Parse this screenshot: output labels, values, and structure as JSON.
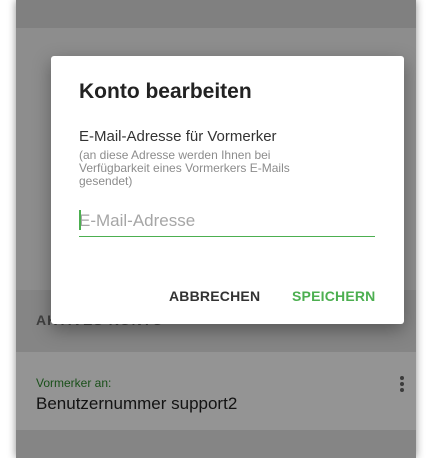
{
  "background": {
    "section_title": "AKTIVES KONTO",
    "account_label": "Vormerker an:",
    "account_value": "Benutzernummer support2"
  },
  "dialog": {
    "title": "Konto bearbeiten",
    "field_label": "E-Mail-Adresse für Vormerker",
    "field_hint": "(an diese Adresse werden Ihnen bei Verfügbarkeit eines Vormerkers E-Mails gesendet)",
    "email_value": "",
    "email_placeholder": "E-Mail-Adresse",
    "cancel_label": "ABBRECHEN",
    "save_label": "SPEICHERN"
  },
  "colors": {
    "accent": "#4caf50",
    "account_label": "#2e8a2e"
  },
  "icons": {
    "more": "more-vert-icon"
  }
}
